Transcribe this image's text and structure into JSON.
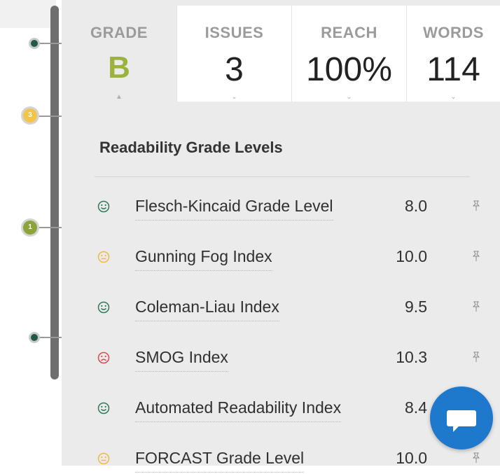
{
  "stats": [
    {
      "label": "GRADE",
      "value": "B"
    },
    {
      "label": "ISSUES",
      "value": "3"
    },
    {
      "label": "REACH",
      "value": "100%"
    },
    {
      "label": "WORDS",
      "value": "114"
    }
  ],
  "timeline": {
    "badges": [
      "3",
      "1"
    ]
  },
  "readability": {
    "title": "Readability Grade Levels",
    "rows": [
      {
        "name": "Flesch-Kincaid Grade Level",
        "value": "8.0",
        "mood": "happy",
        "mood_color": "#2f7a55"
      },
      {
        "name": "Gunning Fog Index",
        "value": "10.0",
        "mood": "neutral",
        "mood_color": "#f0b84a"
      },
      {
        "name": "Coleman-Liau Index",
        "value": "9.5",
        "mood": "happy",
        "mood_color": "#2f7a55"
      },
      {
        "name": "SMOG Index",
        "value": "10.3",
        "mood": "sad",
        "mood_color": "#e0484e"
      },
      {
        "name": "Automated Readability Index",
        "value": "8.4",
        "mood": "happy",
        "mood_color": "#2f7a55"
      },
      {
        "name": "FORCAST Grade Level",
        "value": "10.0",
        "mood": "neutral",
        "mood_color": "#f0b84a"
      }
    ]
  },
  "colors": {
    "grade_accent": "#9bb33e",
    "chat_button": "#1e78cc"
  },
  "icons": {
    "row_pin": "pin-icon",
    "chat": "chat-bubble-icon"
  }
}
